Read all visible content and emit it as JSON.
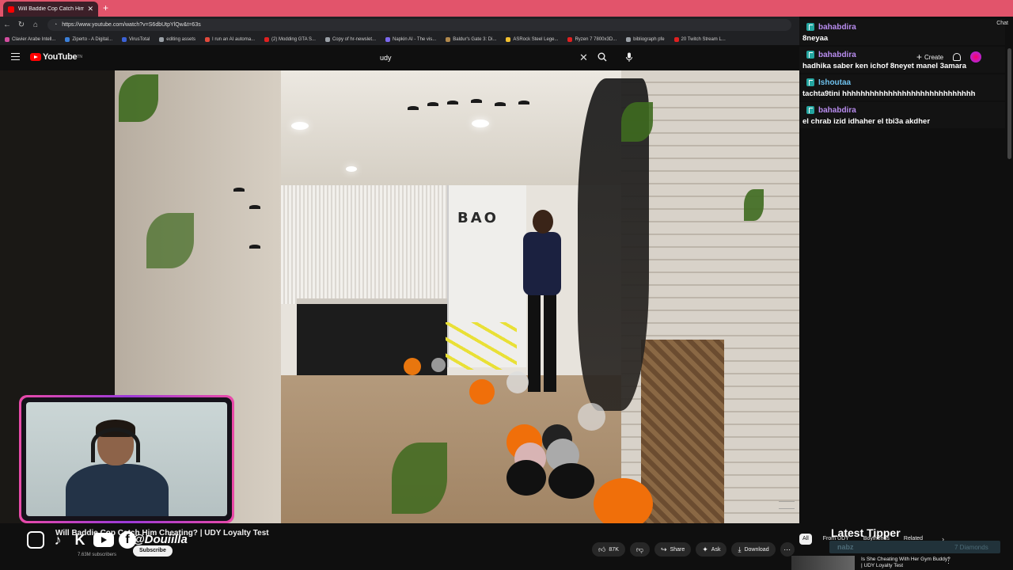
{
  "browser": {
    "tab_title": "Will Baddie Cop Catch Him Ch",
    "url": "https://www.youtube.com/watch?v=S6dbUtpYlQw&t=63s",
    "chat_label": "Chat",
    "bookmarks": [
      {
        "label": "Clavier Arabe Intell...",
        "color": "#d34da0"
      },
      {
        "label": "Ziperto - A Digital...",
        "color": "#3b7fd9"
      },
      {
        "label": "VirusTotal",
        "color": "#3c62d6"
      },
      {
        "label": "editing assets",
        "color": "#9aa0a6"
      },
      {
        "label": "I run an AI automa...",
        "color": "#e34a3c"
      },
      {
        "label": "(2) Modding GTA S...",
        "color": "#e02020"
      },
      {
        "label": "Copy of hr-newslet...",
        "color": "#9aa0a6"
      },
      {
        "label": "Napkin AI - The vis...",
        "color": "#7b68ee"
      },
      {
        "label": "Baldur's Gate 3: Di...",
        "color": "#b0884c"
      },
      {
        "label": "ASRock Steel Lege...",
        "color": "#f2c02f"
      },
      {
        "label": "Ryzen 7 7800x3D...",
        "color": "#e02020"
      },
      {
        "label": "bibliograph pfe",
        "color": "#9aa0a6"
      },
      {
        "label": "20 Twitch Stream L...",
        "color": "#e02020"
      }
    ]
  },
  "youtube": {
    "logo_text": "YouTube",
    "logo_tm": "TN",
    "search_value": "udy",
    "create_label": "Create"
  },
  "chat": {
    "messages": [
      {
        "user": "bahabdira",
        "text": "8neyaa",
        "color": "#b98df0"
      },
      {
        "user": "bahabdira",
        "text": "hadhika saber ken ichof 8neyet manel 3amara",
        "color": "#b98df0"
      },
      {
        "user": "Ishoutaa",
        "text": "tachta9tini hhhhhhhhhhhhhhhhhhhhhhhhhhhhh",
        "color": "#6fc2ee"
      },
      {
        "user": "bahabdira",
        "text": "el chrab izid idhaher el tbi3a akdher",
        "color": "#b98df0"
      }
    ]
  },
  "video": {
    "title": "Will Baddie Cop Catch Him Cheating? | UDY Loyalty Test",
    "handle": "@Douiilla",
    "subscribe_label": "Subscribe",
    "subscribers": "7.63M subscribers",
    "likes": "87K",
    "share_label": "Share",
    "ask_label": "Ask",
    "download_label": "Download",
    "scene_letters": "BAO"
  },
  "sidebar": {
    "chips": [
      "All",
      "From UDY",
      "Boyfriends",
      "Related"
    ],
    "latest_tipper_label": "Latest Tipper",
    "tipper_name": "nabz",
    "tipper_amount": "7 Diamonds",
    "recommended_title": "Is She Cheating With Her Gym Buddy? | UDY Loyalty Test"
  },
  "colors": {
    "brand_red": "#ff0000",
    "tab_bar": "#e2546b",
    "cam_border": "#e94aa8",
    "chat_user": "#b98df0"
  }
}
